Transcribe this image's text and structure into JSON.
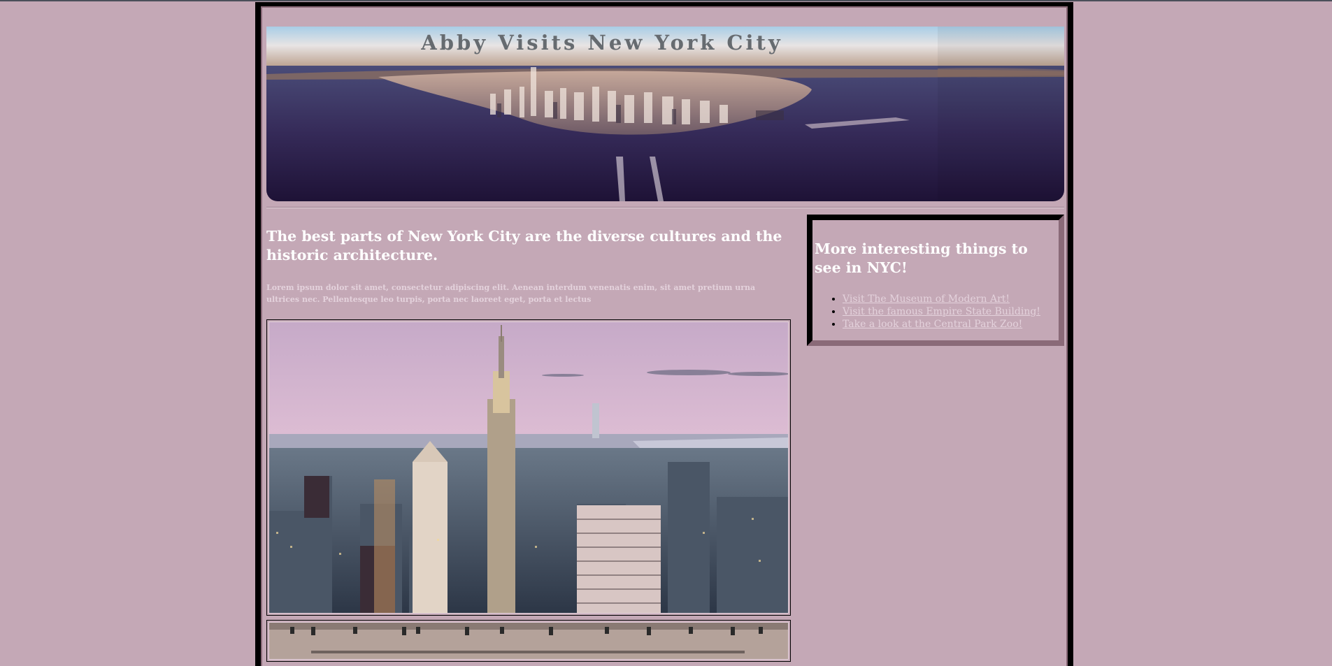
{
  "header": {
    "title": "Abby Visits New York City"
  },
  "main": {
    "heading": "The best parts of New York City are the diverse cultures and the historic architecture.",
    "paragraph": "Lorem ipsum dolor sit amet, consectetur adipiscing elit. Aenean interdum venenatis enim, sit amet pretium urna ultrices nec. Pellentesque leo turpis, porta nec laoreet eget, porta et lectus"
  },
  "sidebar": {
    "heading": "More interesting things to see in NYC!",
    "links": [
      "Visit The Museum of Modern Art!",
      "Visit the famous Empire State Building!",
      "Take a look at the Central Park Zoo!"
    ]
  },
  "colors": {
    "page_background": "#c4a8b6",
    "frame_border": "#000000",
    "frame_shadow": "#8a6a78",
    "heading_text": "#ffffff",
    "muted_text": "#e4d2dc",
    "banner_title": "#666b70"
  }
}
